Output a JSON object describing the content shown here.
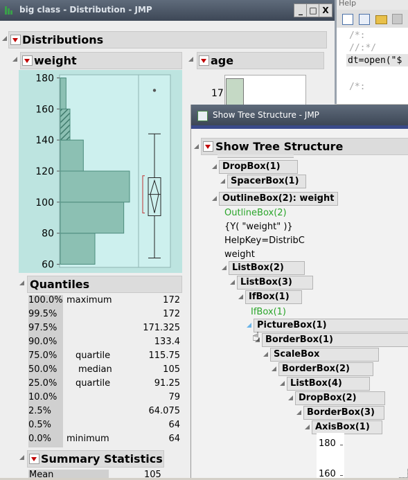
{
  "main_window": {
    "title": "big class - Distribution - JMP",
    "controls": [
      "_",
      "□",
      "X"
    ]
  },
  "script_pane": {
    "menu": "Help",
    "lines": [
      "/*:",
      "//:*/",
      "dt=open(\"$",
      "/*:"
    ]
  },
  "distributions": {
    "title": "Distributions",
    "weight": {
      "title": "weight",
      "y_ticks": [
        "180",
        "160",
        "140",
        "120",
        "100",
        "80",
        "60"
      ]
    },
    "age": {
      "title": "age",
      "first_tick": "17"
    }
  },
  "chart_data": {
    "type": "bar",
    "title": "weight",
    "orientation": "horizontal histogram",
    "bins": [
      [
        60,
        80
      ],
      [
        80,
        100
      ],
      [
        100,
        120
      ],
      [
        120,
        140
      ],
      [
        140,
        160
      ],
      [
        160,
        180
      ]
    ],
    "counts": [
      6,
      11,
      12,
      4,
      1,
      1
    ],
    "highlighted_bin": [
      140,
      160
    ],
    "ylim": [
      58,
      182
    ],
    "boxplot": {
      "min": 64,
      "q1": 91.25,
      "median": 105,
      "q3": 115.75,
      "max": 144,
      "outlier": 172
    },
    "colors": {
      "background": "#bde4e0",
      "bar": "#8cc0b3",
      "bar_border": "#4c8b7c",
      "plot": "#cdf0ee"
    }
  },
  "quantiles": {
    "title": "Quantiles",
    "rows": [
      {
        "pct": "100.0%",
        "label": "maximum",
        "value": "172"
      },
      {
        "pct": "99.5%",
        "label": "",
        "value": "172"
      },
      {
        "pct": "97.5%",
        "label": "",
        "value": "171.325"
      },
      {
        "pct": "90.0%",
        "label": "",
        "value": "133.4"
      },
      {
        "pct": "75.0%",
        "label": "quartile",
        "value": "115.75"
      },
      {
        "pct": "50.0%",
        "label": "median",
        "value": "105"
      },
      {
        "pct": "25.0%",
        "label": "quartile",
        "value": "91.25"
      },
      {
        "pct": "10.0%",
        "label": "",
        "value": "79"
      },
      {
        "pct": "2.5%",
        "label": "",
        "value": "64.075"
      },
      {
        "pct": "0.5%",
        "label": "",
        "value": "64"
      },
      {
        "pct": "0.0%",
        "label": "minimum",
        "value": "64"
      }
    ]
  },
  "summary": {
    "title": "Summary Statistics",
    "row_label": "Mean",
    "row_value": "105"
  },
  "tree_window": {
    "title": "Show Tree Structure - JMP",
    "header": "Show Tree Structure",
    "nodes": [
      {
        "text": "DropBox(1)",
        "kind": "box"
      },
      {
        "text": "SpacerBox(1)",
        "kind": "box"
      },
      {
        "text": "OutlineBox(2): weight",
        "kind": "box"
      },
      {
        "text": "OutlineBox(2)",
        "kind": "green"
      },
      {
        "text": "{Y( \"weight\" )}",
        "kind": "plain"
      },
      {
        "text": "HelpKey=DistribC",
        "kind": "plain"
      },
      {
        "text": "weight",
        "kind": "plain"
      },
      {
        "text": "ListBox(2)",
        "kind": "box"
      },
      {
        "text": "ListBox(3)",
        "kind": "box"
      },
      {
        "text": "IfBox(1)",
        "kind": "box"
      },
      {
        "text": "IfBox(1)",
        "kind": "green"
      },
      {
        "text": "PictureBox(1)",
        "kind": "box"
      },
      {
        "text": "BorderBox(1)",
        "kind": "box"
      },
      {
        "text": "ScaleBox",
        "kind": "box"
      },
      {
        "text": "BorderBox(2)",
        "kind": "box"
      },
      {
        "text": "ListBox(4)",
        "kind": "box"
      },
      {
        "text": "DropBox(2)",
        "kind": "box"
      },
      {
        "text": "BorderBox(3)",
        "kind": "box"
      },
      {
        "text": "AxisBox(1)",
        "kind": "box"
      }
    ],
    "axis_ticks": [
      "180",
      "160"
    ]
  }
}
